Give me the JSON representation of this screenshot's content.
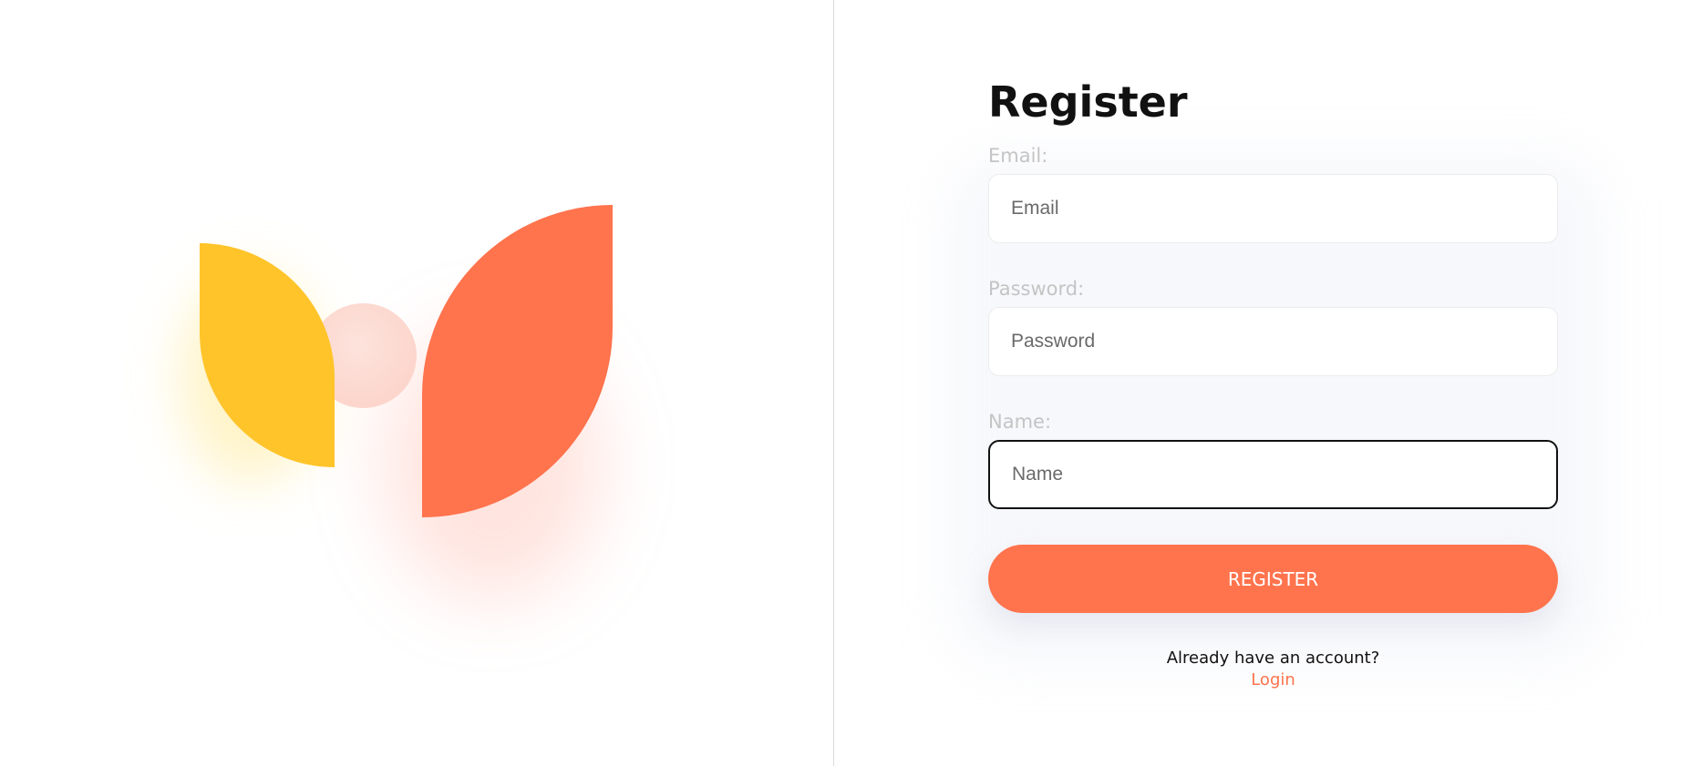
{
  "register": {
    "title": "Register",
    "email": {
      "label": "Email:",
      "placeholder": "Email",
      "value": ""
    },
    "password": {
      "label": "Password:",
      "placeholder": "Password",
      "value": ""
    },
    "name": {
      "label": "Name:",
      "placeholder": "Name",
      "value": ""
    },
    "submit_label": "REGISTER",
    "footer_text": "Already have an account?",
    "login_link": "Login"
  },
  "colors": {
    "accent": "#ff734d",
    "yellow": "#ffc42a",
    "pink": "#fbd0c5",
    "label": "#c4c4c4",
    "title": "#111111"
  },
  "icons": [
    "yellow-leaf-shape",
    "orange-leaf-shape",
    "pink-circle-shape"
  ]
}
